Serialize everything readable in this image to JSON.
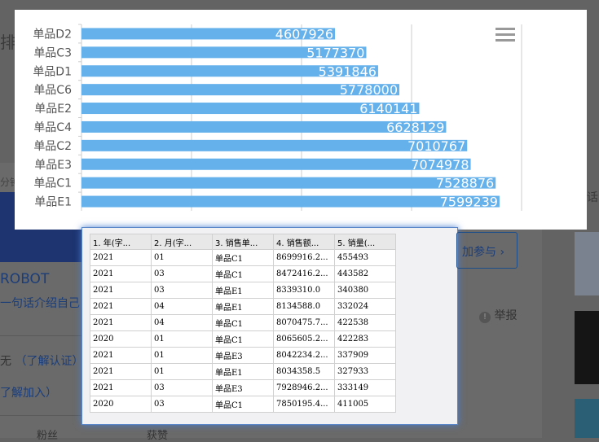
{
  "background": {
    "title_fragment": "排行",
    "minutes_fragment": "分钟",
    "robot": "ROBOT",
    "intro": "一句话介绍自己",
    "cert_prefix": "无",
    "cert_link": "（了解认证）",
    "join_link": "了解加入）",
    "fans": "粉丝",
    "likes": "获赞",
    "join_button": "加参与",
    "report": "举报",
    "right_fragment": "话"
  },
  "chart_data": {
    "type": "bar",
    "orientation": "horizontal",
    "categories": [
      "单品D2",
      "单品C3",
      "单品D1",
      "单品C6",
      "单品E2",
      "单品C4",
      "单品C2",
      "单品E3",
      "单品C1",
      "单品E1"
    ],
    "values": [
      4607926,
      5177370,
      5391846,
      5778000,
      6140141,
      6628129,
      7010767,
      7074978,
      7528876,
      7599239
    ],
    "xlim": [
      0,
      8000000
    ],
    "gridlines": [
      2000000,
      4000000,
      6000000,
      8000000
    ],
    "color": "#65b1ec",
    "data_labels": true
  },
  "table": {
    "headers": [
      "1. 年(字...",
      "2. 月(字...",
      "3. 销售单...",
      "4. 销售额...",
      "5. 销量(..."
    ],
    "rows": [
      [
        "2021",
        "01",
        "单品C1",
        "8699916.2...",
        "455493"
      ],
      [
        "2021",
        "03",
        "单品C1",
        "8472416.2...",
        "443582"
      ],
      [
        "2021",
        "03",
        "单品E1",
        "8339310.0",
        "340380"
      ],
      [
        "2021",
        "04",
        "单品E1",
        "8134588.0",
        "332024"
      ],
      [
        "2021",
        "04",
        "单品C1",
        "8070475.7...",
        "422538"
      ],
      [
        "2020",
        "01",
        "单品C1",
        "8065605.2...",
        "422283"
      ],
      [
        "2021",
        "01",
        "单品E3",
        "8042234.2...",
        "337909"
      ],
      [
        "2021",
        "01",
        "单品E1",
        "8034358.5",
        "327933"
      ],
      [
        "2021",
        "03",
        "单品E3",
        "7928946.2...",
        "333149"
      ],
      [
        "2020",
        "03",
        "单品C1",
        "7850195.4...",
        "411005"
      ]
    ]
  }
}
